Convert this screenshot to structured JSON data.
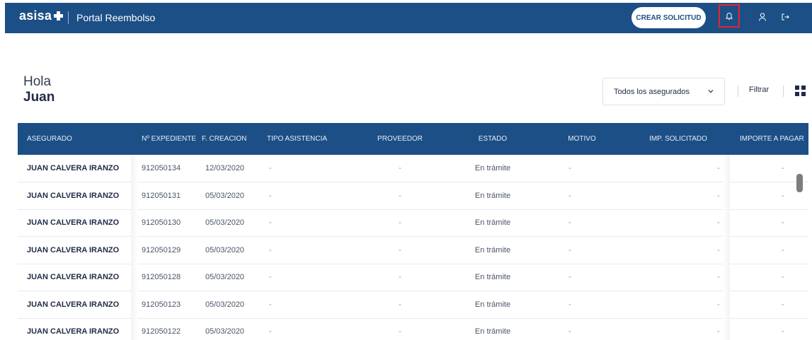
{
  "header": {
    "logo": "asisa",
    "app_name": "Portal Reembolso",
    "create_button": "CREAR SOLICITUD",
    "icons": [
      "bell-icon",
      "user-icon",
      "logout-icon"
    ],
    "colors": {
      "brand": "#1c4f86",
      "highlight": "#e3262b"
    }
  },
  "greeting": {
    "hello": "Hola",
    "name": "Juan"
  },
  "toolbar": {
    "insured_select": "Todos los asegurados",
    "filter": "Filtrar"
  },
  "table": {
    "columns": [
      "ASEGURADO",
      "Nº EXPEDIENTE",
      "F. CREACION",
      "TIPO ASISTENCIA",
      "PROVEEDOR",
      "ESTADO",
      "MOTIVO",
      "IMP. SOLICITADO",
      "IMPORTE A PAGAR"
    ],
    "rows": [
      [
        "JUAN CALVERA IRANZO",
        "912050134",
        "12/03/2020",
        "-",
        "-",
        "En trámite",
        "-",
        "-",
        "-"
      ],
      [
        "JUAN CALVERA IRANZO",
        "912050131",
        "05/03/2020",
        "-",
        "-",
        "En trámite",
        "-",
        "-",
        "-"
      ],
      [
        "JUAN CALVERA IRANZO",
        "912050130",
        "05/03/2020",
        "-",
        "-",
        "En trámite",
        "-",
        "-",
        "-"
      ],
      [
        "JUAN CALVERA IRANZO",
        "912050129",
        "05/03/2020",
        "-",
        "-",
        "En trámite",
        "-",
        "-",
        "-"
      ],
      [
        "JUAN CALVERA IRANZO",
        "912050128",
        "05/03/2020",
        "-",
        "-",
        "En trámite",
        "-",
        "-",
        "-"
      ],
      [
        "JUAN CALVERA IRANZO",
        "912050123",
        "05/03/2020",
        "-",
        "-",
        "En trámite",
        "-",
        "-",
        "-"
      ],
      [
        "JUAN CALVERA IRANZO",
        "912050122",
        "05/03/2020",
        "-",
        "-",
        "En trámite",
        "-",
        "-",
        "-"
      ]
    ]
  }
}
